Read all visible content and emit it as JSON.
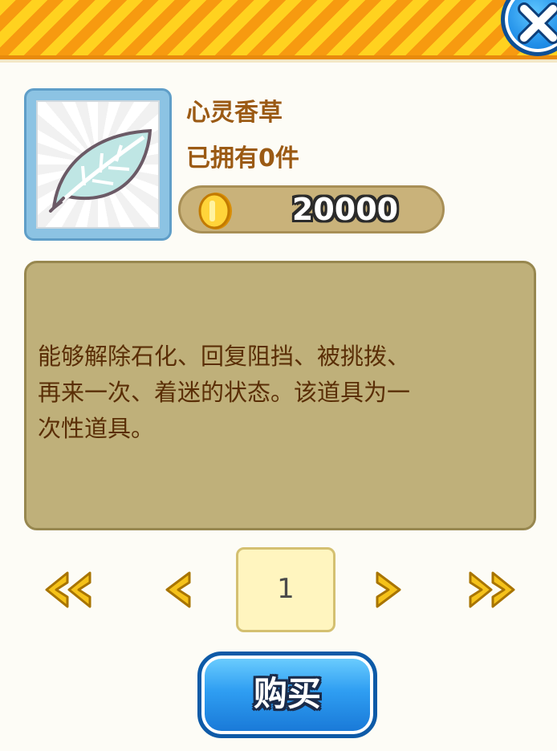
{
  "item": {
    "name": "心灵香草",
    "owned": "已拥有0件",
    "price": "20000",
    "description": "能够解除石化、回复阻挡、被挑拨、\n再来一次、着迷的状态。该道具为一\n次性道具。"
  },
  "pager": {
    "page": "1"
  },
  "buy_button": {
    "label": "购买"
  },
  "icons": {
    "close": "close-icon",
    "item": "leaf-icon",
    "coin": "coin-icon",
    "first": "double-left-arrow-icon",
    "prev": "left-arrow-icon",
    "next": "right-arrow-icon",
    "last": "double-right-arrow-icon"
  },
  "colors": {
    "title_text": "#9b5a14",
    "description_text": "#5a2e06",
    "button_blue": "#2f9ef2",
    "arrow_gold": "#f5c21a"
  }
}
